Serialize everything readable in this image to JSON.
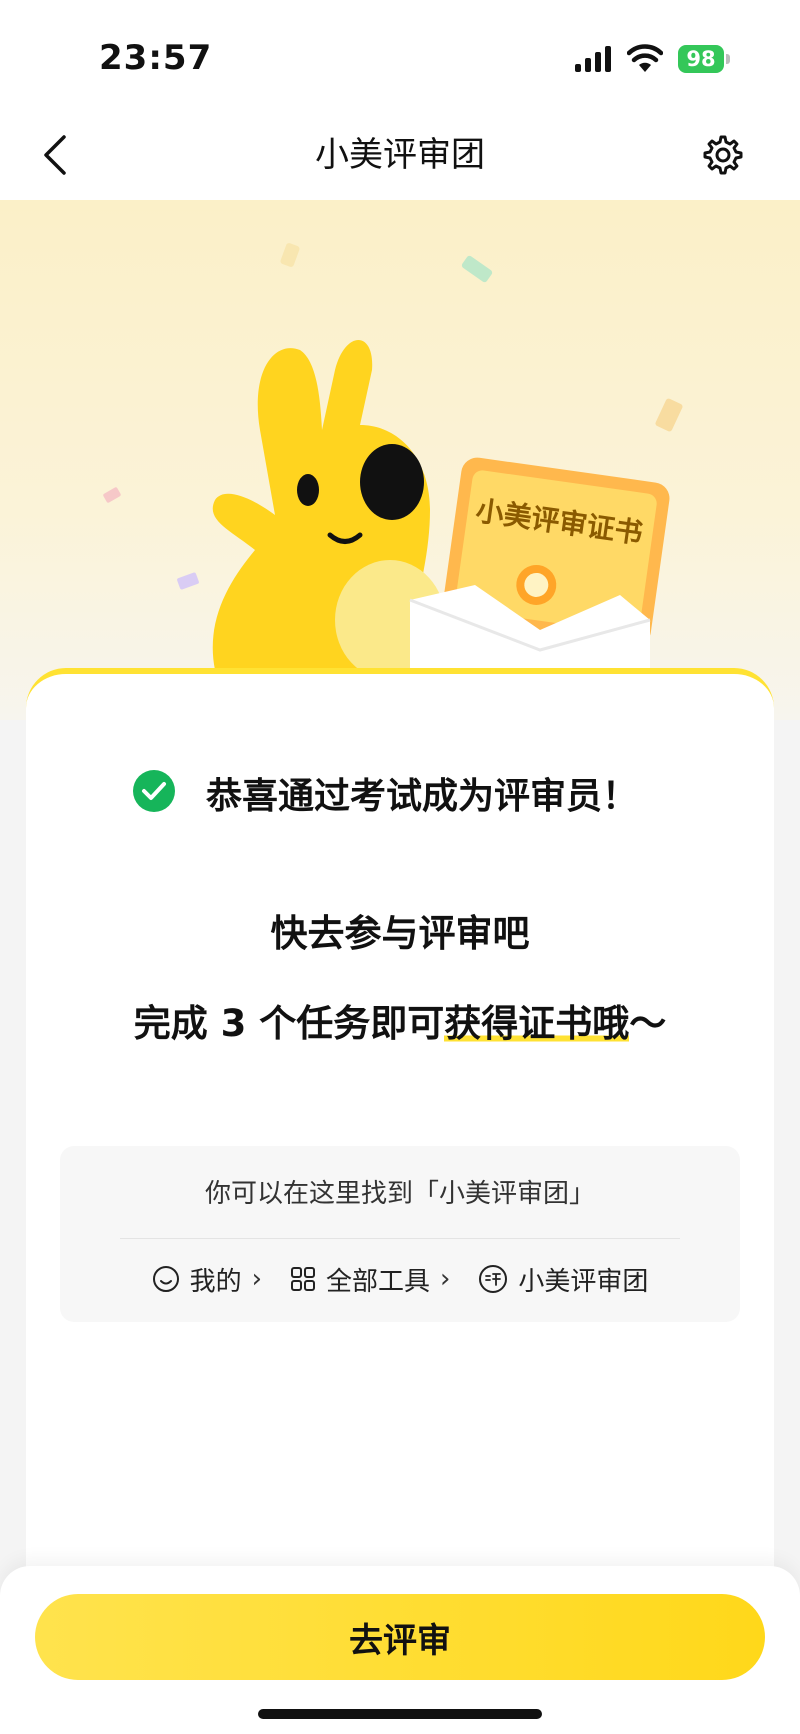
{
  "status_bar": {
    "time": "23:57",
    "battery": "98"
  },
  "nav": {
    "title": "小美评审团"
  },
  "hero": {
    "certificate_title": "小美评审证书"
  },
  "content": {
    "success_message": "恭喜通过考试成为评审员！",
    "heading": "快去参与评审吧",
    "task_prefix": "完成 3 个任务即可",
    "task_highlight": "获得证书哦",
    "task_suffix": "～"
  },
  "info_box": {
    "hint": "你可以在这里找到「小美评审团」",
    "path": [
      {
        "label": "我的",
        "icon": "smile-icon"
      },
      {
        "label": "全部工具",
        "icon": "grid-icon"
      },
      {
        "label": "小美评审团",
        "icon": "review-badge-icon"
      }
    ]
  },
  "bottom": {
    "button_label": "去评审"
  },
  "colors": {
    "accent": "#ffe233",
    "success": "#16b55a",
    "battery": "#34c759"
  }
}
